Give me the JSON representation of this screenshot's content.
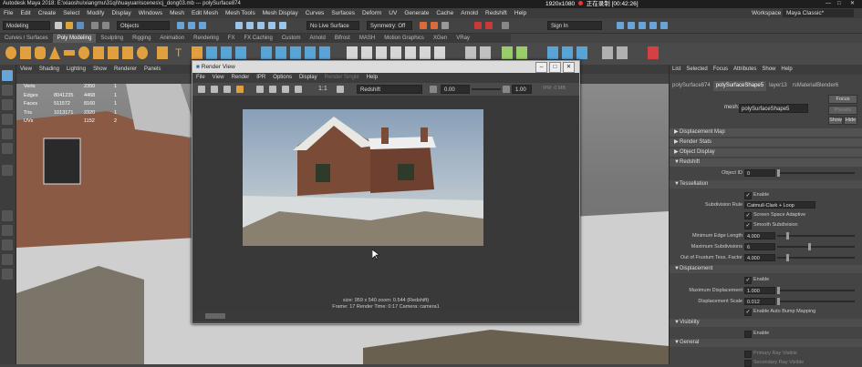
{
  "window": {
    "title": "Autodesk Maya 2018: E:\\xiaoshu\\xiangmu\\31qi\\huayuan\\scenes\\cj_dong03.mb  ---  polySurface874",
    "record_size": "1920x1080",
    "record_status": "正在录制 [00:42:26]"
  },
  "menubar": {
    "items": [
      "File",
      "Edit",
      "Create",
      "Select",
      "Modify",
      "Display",
      "Windows",
      "Mesh",
      "Edit Mesh",
      "Mesh Tools",
      "Mesh Display",
      "Curves",
      "Surfaces",
      "Deform",
      "UV",
      "Generate",
      "Cache",
      "Arnold",
      "Redshift",
      "Help"
    ],
    "workspace_label": "Workspace :",
    "workspace_value": "Maya Classic*"
  },
  "toolbar": {
    "mode": "Modeling",
    "objects": "Objects",
    "live_surface": "No Live Surface",
    "symmetry": "Symmetry: Off",
    "sign_in": "Sign In"
  },
  "shelf": {
    "tabs": [
      "Curves / Surfaces",
      "Poly Modeling",
      "Sculpting",
      "Rigging",
      "Animation",
      "Rendering",
      "FX",
      "FX Caching",
      "Custom",
      "Arnold",
      "Bifrost",
      "MASH",
      "Motion Graphics",
      "XGen",
      "VRay"
    ],
    "active_tab": 1
  },
  "viewport": {
    "menu": [
      "View",
      "Shading",
      "Lighting",
      "Show",
      "Renderer",
      "Panels"
    ],
    "hud": [
      {
        "label": "Verts",
        "a": "",
        "b": "2350",
        "c": "1"
      },
      {
        "label": "Edges",
        "a": "8041235",
        "b": "4468",
        "c": "1"
      },
      {
        "label": "Faces",
        "a": "511572",
        "b": "8160",
        "c": "1"
      },
      {
        "label": "Tris",
        "a": "1013171",
        "b": "2320",
        "c": "1"
      },
      {
        "label": "UVs",
        "a": "",
        "b": "1152",
        "c": "2"
      }
    ]
  },
  "render_view": {
    "title": "Render View",
    "menu": [
      "File",
      "View",
      "Render",
      "IPR",
      "Options",
      "Display",
      "Render Single",
      "Help"
    ],
    "ratio": "1:1",
    "renderer": "Redshift",
    "exposure": "0.00",
    "gamma": "1.00",
    "ipr": "IPR: 0 MB",
    "info_line1": "size: 959 x 540  zoom: 0.544      (Redshift)",
    "info_line2": "Frame: 17      Render Time: 0:17      Camera: camera1"
  },
  "attribute_editor": {
    "menu": [
      "List",
      "Selected",
      "Focus",
      "Attributes",
      "Show",
      "Help"
    ],
    "tabs": [
      "polySurface874",
      "polySurfaceShape5",
      "layer13",
      "rsMaterialBlender6"
    ],
    "active_tab": 1,
    "mesh_label": "mesh:",
    "mesh_value": "polySurfaceShape5",
    "focus_btn": "Focus",
    "presets_btn": "Presets",
    "show_btn": "Show",
    "hide_btn": "Hide",
    "sections_top": [
      "Displacement Map",
      "Render Stats",
      "Object Display",
      "Redshift"
    ],
    "object_id_label": "Object ID",
    "object_id_value": "0",
    "tessellation": "Tessellation",
    "enable": "Enable",
    "subdiv_rule_label": "Subdivision Rule",
    "subdiv_rule_value": "Catmull-Clark + Loop",
    "screen_space": "Screen Space Adaptive",
    "smooth_subdiv": "Smooth Subdivision",
    "min_edge_label": "Minimum Edge Length",
    "min_edge_value": "4.000",
    "max_subdiv_label": "Maximum Subdivisions",
    "max_subdiv_value": "6",
    "out_frustum_label": "Out of Frustum Tess. Factor",
    "out_frustum_value": "4.000",
    "displacement": "Displacement",
    "max_disp_label": "Maximum Displacement",
    "max_disp_value": "1.000",
    "disp_scale_label": "Displacement Scale",
    "disp_scale_value": "0.012",
    "auto_bump": "Enable Auto Bump Mapping",
    "visibility": "Visibility",
    "general": "General",
    "primary_ray": "Primary Ray Visible",
    "secondary_ray": "Secondary Ray Visible"
  }
}
